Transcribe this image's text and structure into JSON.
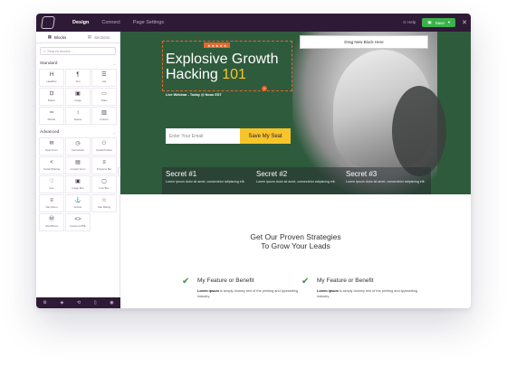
{
  "topbar": {
    "tabs": [
      "Design",
      "Connect",
      "Page Settings"
    ],
    "help_label": "Help",
    "save_label": "Save",
    "close_glyph": "✕",
    "save_color": "#3bb24b",
    "bar_color": "#2e1a36"
  },
  "sidebar": {
    "tab_blocks": "Blocks",
    "tab_sections": "Sections",
    "search_placeholder": "Search blocks...",
    "standard_label": "Standard",
    "advanced_label": "Advanced",
    "standard_items": [
      {
        "label": "Headline",
        "icon": "heading-icon",
        "glyph": "H"
      },
      {
        "label": "Text",
        "icon": "paragraph-icon",
        "glyph": "¶"
      },
      {
        "label": "List",
        "icon": "list-icon",
        "glyph": "☰"
      },
      {
        "label": "Button",
        "icon": "button-icon",
        "glyph": "⊡"
      },
      {
        "label": "Image",
        "icon": "image-icon",
        "glyph": "▣"
      },
      {
        "label": "Video",
        "icon": "video-icon",
        "glyph": "▭"
      },
      {
        "label": "Divider",
        "icon": "divider-icon",
        "glyph": "═"
      },
      {
        "label": "Spacer",
        "icon": "spacer-icon",
        "glyph": "↕"
      },
      {
        "label": "Column",
        "icon": "column-icon",
        "glyph": "▥"
      }
    ],
    "advanced_items": [
      {
        "label": "Optin Form",
        "icon": "form-icon",
        "glyph": "✉"
      },
      {
        "label": "Countdown",
        "icon": "countdown-icon",
        "glyph": "◷"
      },
      {
        "label": "Social Profiles",
        "icon": "social-profiles-icon",
        "glyph": "⚇"
      },
      {
        "label": "Social Sharing",
        "icon": "share-icon",
        "glyph": "<"
      },
      {
        "label": "Contact Form",
        "icon": "contact-form-icon",
        "glyph": "▤"
      },
      {
        "label": "Progress Bar",
        "icon": "progress-bar-icon",
        "glyph": "≡"
      },
      {
        "label": "Icon",
        "icon": "heart-icon",
        "glyph": "♡"
      },
      {
        "label": "Image Box",
        "icon": "image-box-icon",
        "glyph": "▣"
      },
      {
        "label": "Icon Box",
        "icon": "icon-box-icon",
        "glyph": "▢"
      },
      {
        "label": "Nav Menu",
        "icon": "nav-menu-icon",
        "glyph": "≡"
      },
      {
        "label": "Anchor",
        "icon": "anchor-icon",
        "glyph": "⚓"
      },
      {
        "label": "Star Rating",
        "icon": "star-icon",
        "glyph": "☆"
      },
      {
        "label": "WordPress",
        "icon": "wordpress-icon",
        "glyph": "Ⓦ"
      },
      {
        "label": "Custom HTML",
        "icon": "code-icon",
        "glyph": "<>"
      }
    ],
    "footer_icons": [
      {
        "icon": "settings-icon",
        "glyph": "⚙"
      },
      {
        "icon": "layers-icon",
        "glyph": "◈"
      },
      {
        "icon": "history-icon",
        "glyph": "⟲"
      },
      {
        "icon": "mobile-icon",
        "glyph": "▯"
      },
      {
        "icon": "preview-eye-icon",
        "glyph": "◉"
      }
    ]
  },
  "canvas": {
    "drag_label": "Drag New Block Here",
    "stars_label": "★ ★ ★ ★ ★",
    "title_line1": "Explosive Growth",
    "title_line2": "Hacking ",
    "title_accent": "101",
    "badge": "×",
    "subtitle": "Live Webinar - Today @ Noon EST",
    "email_placeholder": "Enter Your Email",
    "cta_label": "Save My Seat",
    "secrets": [
      {
        "title": "Secret #1",
        "text": "Lorem ipsum dolor sit amet, consectetur adipiscing elit."
      },
      {
        "title": "Secret #2",
        "text": "Lorem ipsum dolor sit amet, consectetur adipiscing elit."
      },
      {
        "title": "Secret #3",
        "text": "Lorem ipsum dolor sit amet, consectetur adipiscing elit."
      }
    ],
    "heading_line1": "Get Our Proven Strategies",
    "heading_line2": "To Grow Your Leads",
    "features": [
      {
        "title": "My Feature or Benefit",
        "bold": "Lorem Ipsum",
        "text": " is simply dummy text of the printing and typesetting industry."
      },
      {
        "title": "My Feature or Benefit",
        "bold": "Lorem Ipsum",
        "text": " is simply dummy text of the printing and typesetting industry."
      }
    ],
    "hero_color": "#2f5b3d",
    "accent_color": "#f7c52a",
    "check_color": "#3d9142"
  }
}
